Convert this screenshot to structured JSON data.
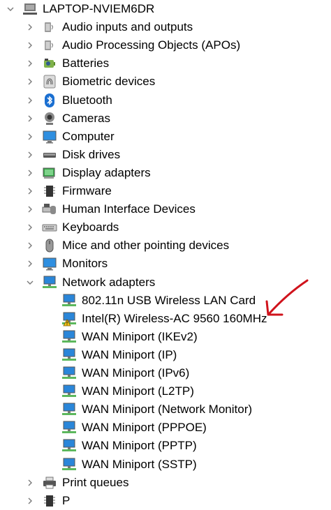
{
  "root": {
    "label": "LAPTOP-NVIEM6DR"
  },
  "categories": [
    {
      "label": "Audio inputs and outputs",
      "icon": "speaker-icon"
    },
    {
      "label": "Audio Processing Objects (APOs)",
      "icon": "speaker-icon"
    },
    {
      "label": "Batteries",
      "icon": "battery-icon"
    },
    {
      "label": "Biometric devices",
      "icon": "fingerprint-icon"
    },
    {
      "label": "Bluetooth",
      "icon": "bluetooth-icon"
    },
    {
      "label": "Cameras",
      "icon": "camera-icon"
    },
    {
      "label": "Computer",
      "icon": "monitor-icon"
    },
    {
      "label": "Disk drives",
      "icon": "disk-icon"
    },
    {
      "label": "Display adapters",
      "icon": "display-adapter-icon"
    },
    {
      "label": "Firmware",
      "icon": "chip-icon"
    },
    {
      "label": "Human Interface Devices",
      "icon": "hid-icon"
    },
    {
      "label": "Keyboards",
      "icon": "keyboard-icon"
    },
    {
      "label": "Mice and other pointing devices",
      "icon": "mouse-icon"
    },
    {
      "label": "Monitors",
      "icon": "monitor-icon"
    },
    {
      "label": "Network adapters",
      "icon": "network-icon",
      "expanded": true
    }
  ],
  "network_children": [
    {
      "label": "802.11n USB Wireless LAN Card",
      "warning": false
    },
    {
      "label": "Intel(R) Wireless-AC 9560 160MHz",
      "warning": true
    },
    {
      "label": "WAN Miniport (IKEv2)",
      "warning": false
    },
    {
      "label": "WAN Miniport (IP)",
      "warning": false
    },
    {
      "label": "WAN Miniport (IPv6)",
      "warning": false
    },
    {
      "label": "WAN Miniport (L2TP)",
      "warning": false
    },
    {
      "label": "WAN Miniport (Network Monitor)",
      "warning": false
    },
    {
      "label": "WAN Miniport (PPPOE)",
      "warning": false
    },
    {
      "label": "WAN Miniport (PPTP)",
      "warning": false
    },
    {
      "label": "WAN Miniport (SSTP)",
      "warning": false
    }
  ],
  "after": [
    {
      "label": "Print queues",
      "icon": "printer-icon"
    },
    {
      "label": "P",
      "icon": "chip-icon"
    }
  ],
  "colors": {
    "chevron": "#7a7a7a",
    "annotation": "#d0131c",
    "network_blue": "#2a86d9",
    "network_green": "#5cb85c"
  }
}
